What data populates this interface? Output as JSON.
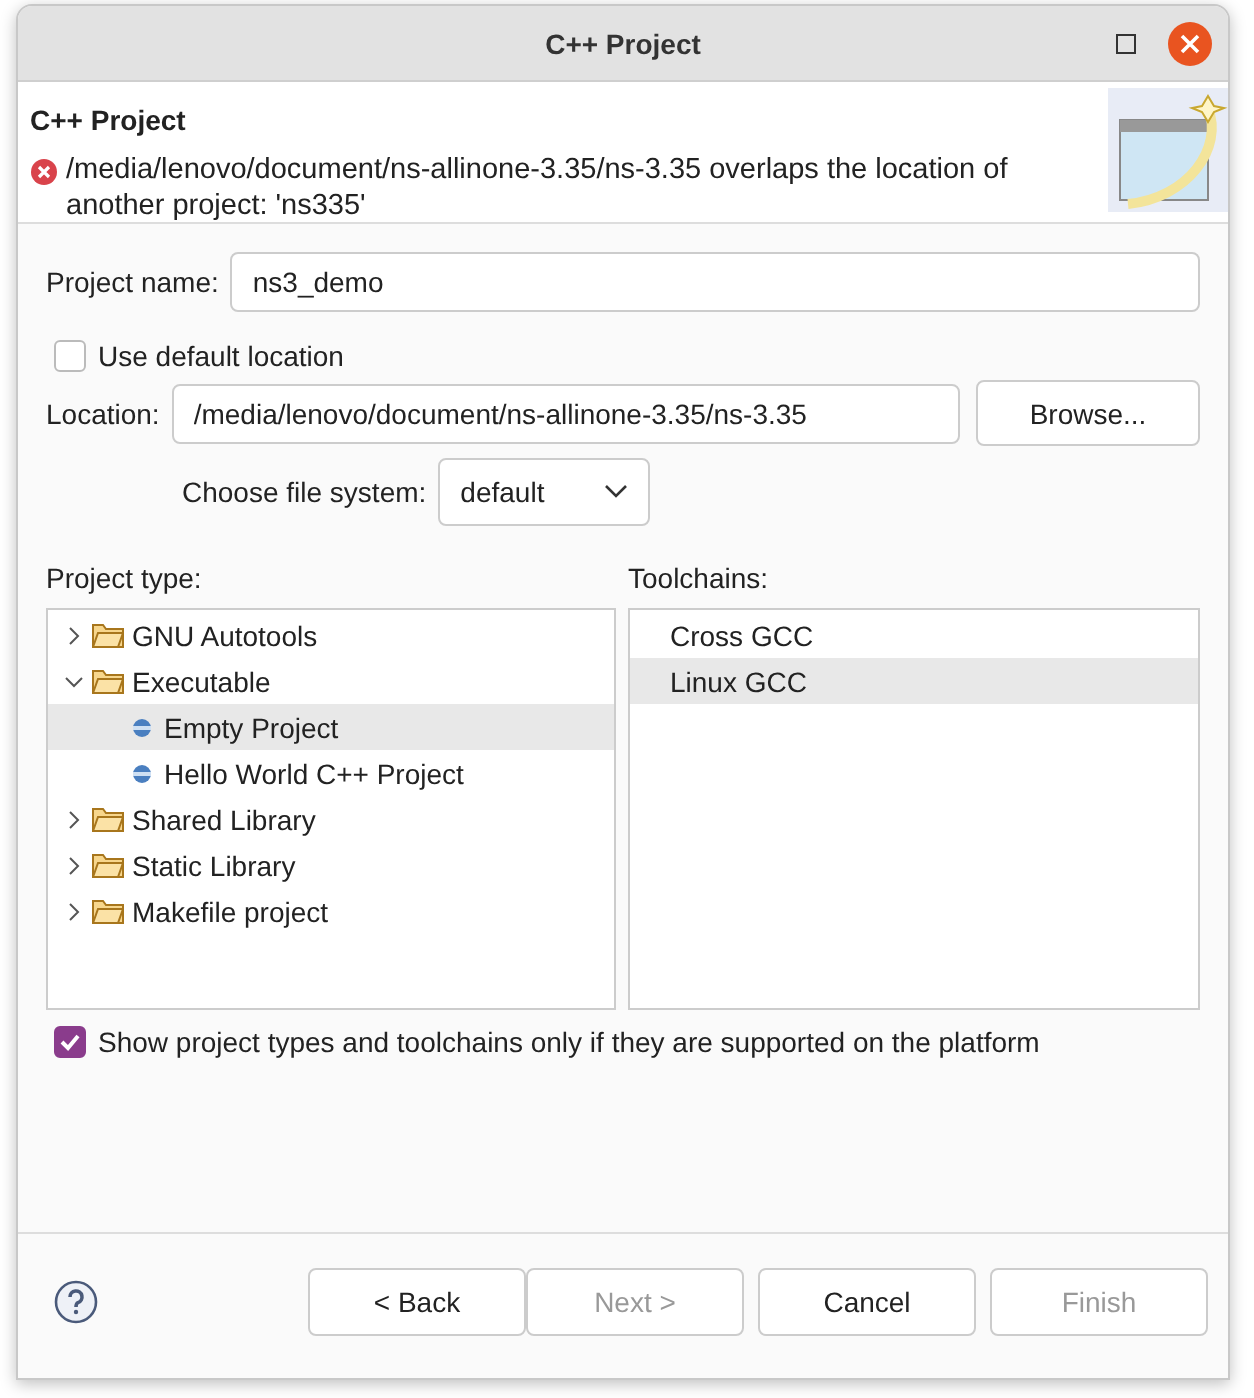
{
  "window": {
    "title": "C++ Project"
  },
  "header": {
    "title": "C++ Project",
    "message": "/media/lenovo/document/ns-allinone-3.35/ns-3.35 overlaps the location of another project: 'ns335'"
  },
  "project_name": {
    "label": "Project name:",
    "value": "ns3_demo"
  },
  "use_default_location": {
    "label": "Use default location",
    "checked": false
  },
  "location": {
    "label": "Location:",
    "value": "/media/lenovo/document/ns-allinone-3.35/ns-3.35",
    "browse": "Browse..."
  },
  "file_system": {
    "label": "Choose file system:",
    "value": "default"
  },
  "project_type": {
    "label": "Project type:",
    "items": [
      {
        "label": "GNU Autotools",
        "expanded": false,
        "selected": false
      },
      {
        "label": "Executable",
        "expanded": true,
        "selected": false,
        "children": [
          {
            "label": "Empty Project",
            "selected": true
          },
          {
            "label": "Hello World C++ Project",
            "selected": false
          }
        ]
      },
      {
        "label": "Shared Library",
        "expanded": false,
        "selected": false
      },
      {
        "label": "Static Library",
        "expanded": false,
        "selected": false
      },
      {
        "label": "Makefile project",
        "expanded": false,
        "selected": false
      }
    ]
  },
  "toolchains": {
    "label": "Toolchains:",
    "items": [
      {
        "label": "Cross GCC",
        "selected": false
      },
      {
        "label": "Linux GCC",
        "selected": true
      }
    ]
  },
  "supported_only": {
    "label": "Show project types and toolchains only if they are supported on the platform",
    "checked": true
  },
  "buttons": [
    {
      "label": "< Back",
      "disabled": false
    },
    {
      "label": "Next >",
      "disabled": true
    },
    {
      "label": "Cancel",
      "disabled": false
    },
    {
      "label": "Finish",
      "disabled": true
    }
  ]
}
